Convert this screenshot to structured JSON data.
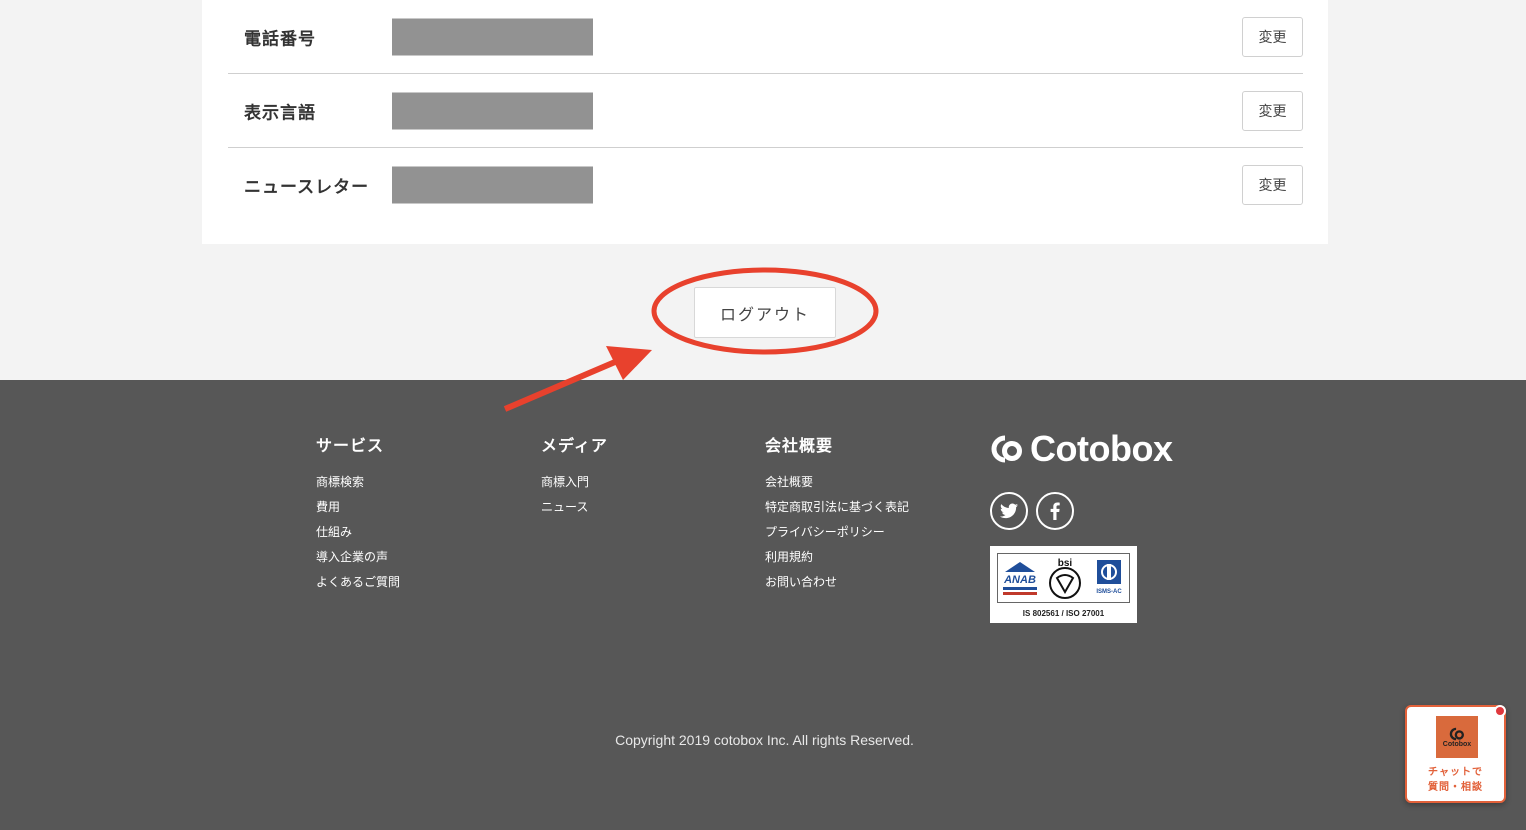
{
  "settings": {
    "rows": [
      {
        "label": "電話番号",
        "button": "変更"
      },
      {
        "label": "表示言語",
        "button": "変更"
      },
      {
        "label": "ニュースレター",
        "button": "変更"
      }
    ]
  },
  "logout": {
    "label": "ログアウト"
  },
  "annotation_color": "#e8412d",
  "footer": {
    "columns": [
      {
        "heading": "サービス",
        "links": [
          "商標検索",
          "費用",
          "仕組み",
          "導入企業の声",
          "よくあるご質問"
        ]
      },
      {
        "heading": "メディア",
        "links": [
          "商標入門",
          "ニュース"
        ]
      },
      {
        "heading": "会社概要",
        "links": [
          "会社概要",
          "特定商取引法に基づく表記",
          "プライバシーポリシー",
          "利用規約",
          "お問い合わせ"
        ]
      }
    ],
    "brand": "Cotobox",
    "socials": [
      "twitter-icon",
      "facebook-icon"
    ],
    "cert": {
      "marks": [
        "ANAB",
        "bsi",
        "ISMS-AC"
      ],
      "text": "IS 802561 / ISO 27001"
    },
    "copyright": "Copyright 2019 cotobox Inc. All rights Reserved."
  },
  "chat": {
    "logo_text": "Cotobox",
    "line1": "チャットで",
    "line2": "質問・相談"
  }
}
